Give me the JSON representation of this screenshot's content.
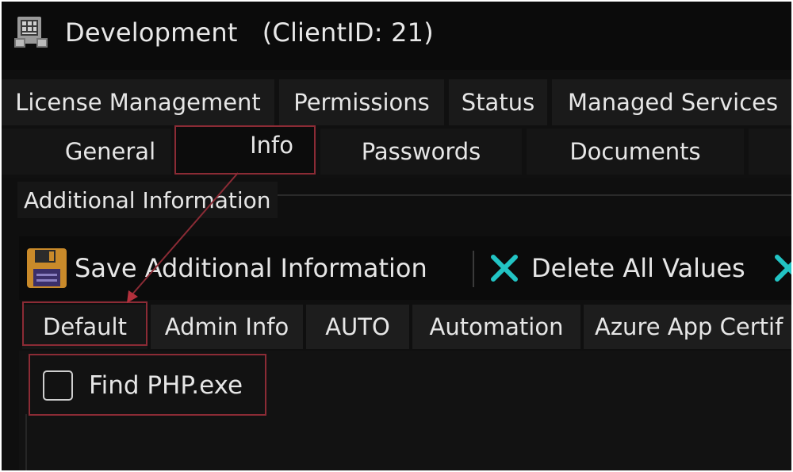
{
  "window": {
    "title": "Development   (ClientID: 21)",
    "icon": "computer-grid-icon"
  },
  "tabs_row1": [
    {
      "label": "License Management"
    },
    {
      "label": "Permissions"
    },
    {
      "label": "Status"
    },
    {
      "label": "Managed Services"
    }
  ],
  "tabs_row2": [
    {
      "label": "General"
    },
    {
      "label": "Info",
      "selected": true
    },
    {
      "label": "Passwords"
    },
    {
      "label": "Documents"
    }
  ],
  "group": {
    "title": "Additional Information"
  },
  "toolbar": {
    "save_label": "Save Additional Information",
    "save_icon": "floppy-disk-icon",
    "delete_label": "Delete All Values",
    "delete_icon": "x-icon"
  },
  "subtabs": [
    {
      "label": "Default",
      "selected": true
    },
    {
      "label": "Admin Info"
    },
    {
      "label": "AUTO"
    },
    {
      "label": "Automation"
    },
    {
      "label": "Azure App Certif"
    }
  ],
  "content": {
    "checkbox_label": "Find PHP.exe",
    "checkbox_checked": false
  },
  "colors": {
    "accent": "#22c4c4",
    "highlight": "#8b2b35",
    "background": "#0f0f0f"
  }
}
